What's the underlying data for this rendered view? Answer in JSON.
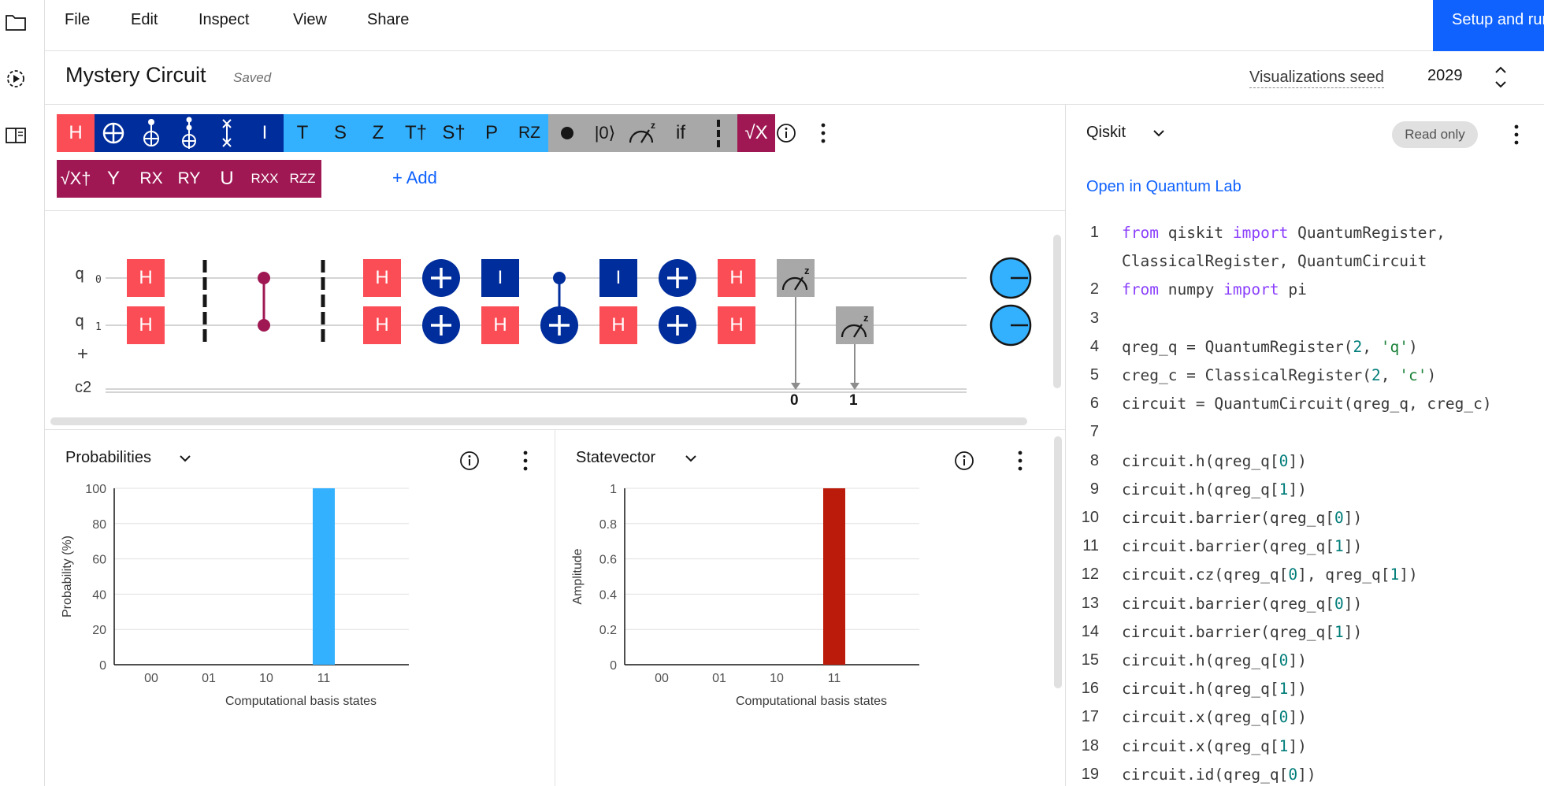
{
  "menu": {
    "items": [
      "File",
      "Edit",
      "Inspect",
      "View",
      "Share"
    ],
    "setup_label": "Setup and run"
  },
  "header": {
    "title": "Mystery Circuit",
    "saved": "Saved",
    "seed_label": "Visualizations seed",
    "seed_value": "2029"
  },
  "palette": {
    "row1": [
      "H",
      "",
      "",
      "",
      "",
      "I",
      "T",
      "S",
      "Z",
      "T†",
      "S†",
      "P",
      "RZ",
      "",
      "|0⟩",
      "",
      "if",
      "",
      "√X"
    ],
    "row2": [
      "√X†",
      "Y",
      "RX",
      "RY",
      "U",
      "RXX",
      "RZZ"
    ],
    "add_label": "+ Add"
  },
  "circuit": {
    "qubit_labels": [
      "q",
      "q"
    ],
    "qubit_indices": [
      "0",
      "1"
    ],
    "creg_label": "c2",
    "add_qubit": "+",
    "q0_gates": [
      "H",
      "H",
      "I",
      "I",
      "H"
    ],
    "q1_gates": [
      "H",
      "H",
      "H",
      "H",
      "H"
    ],
    "measure_bits": [
      "0",
      "1"
    ]
  },
  "probabilities": {
    "title": "Probabilities",
    "chart_data": {
      "type": "bar",
      "categories": [
        "00",
        "01",
        "10",
        "11"
      ],
      "values": [
        0,
        0,
        0,
        100
      ],
      "xlabel": "Computational basis states",
      "ylabel": "Probability (%)",
      "ylim": [
        0,
        100
      ],
      "yticks": [
        "0",
        "20",
        "40",
        "60",
        "80",
        "100"
      ],
      "color": "#33b1ff"
    }
  },
  "statevector": {
    "title": "Statevector",
    "chart_data": {
      "type": "bar",
      "categories": [
        "00",
        "01",
        "10",
        "11"
      ],
      "values": [
        0,
        0,
        0,
        1
      ],
      "xlabel": "Computational basis states",
      "ylabel": "Amplitude",
      "ylim": [
        0,
        1
      ],
      "yticks": [
        "0",
        "0.2",
        "0.4",
        "0.6",
        "0.8",
        "1"
      ],
      "color": "#ba1b0a"
    }
  },
  "code_panel": {
    "language": "Qiskit",
    "badge": "Read only",
    "open_link": "Open in Quantum Lab",
    "lines": [
      {
        "n": "1",
        "t": "from qiskit import QuantumRegister,"
      },
      {
        "n": "",
        "t": "ClassicalRegister, QuantumCircuit"
      },
      {
        "n": "2",
        "t": "from numpy import pi"
      },
      {
        "n": "3",
        "t": ""
      },
      {
        "n": "4",
        "t": "qreg_q = QuantumRegister(2, 'q')"
      },
      {
        "n": "5",
        "t": "creg_c = ClassicalRegister(2, 'c')"
      },
      {
        "n": "6",
        "t": "circuit = QuantumCircuit(qreg_q, creg_c)"
      },
      {
        "n": "7",
        "t": ""
      },
      {
        "n": "8",
        "t": "circuit.h(qreg_q[0])"
      },
      {
        "n": "9",
        "t": "circuit.h(qreg_q[1])"
      },
      {
        "n": "10",
        "t": "circuit.barrier(qreg_q[0])"
      },
      {
        "n": "11",
        "t": "circuit.barrier(qreg_q[1])"
      },
      {
        "n": "12",
        "t": "circuit.cz(qreg_q[0], qreg_q[1])"
      },
      {
        "n": "13",
        "t": "circuit.barrier(qreg_q[0])"
      },
      {
        "n": "14",
        "t": "circuit.barrier(qreg_q[1])"
      },
      {
        "n": "15",
        "t": "circuit.h(qreg_q[0])"
      },
      {
        "n": "16",
        "t": "circuit.h(qreg_q[1])"
      },
      {
        "n": "17",
        "t": "circuit.x(qreg_q[0])"
      },
      {
        "n": "18",
        "t": "circuit.x(qreg_q[1])"
      },
      {
        "n": "19",
        "t": "circuit.id(qreg_q[0])"
      }
    ]
  }
}
